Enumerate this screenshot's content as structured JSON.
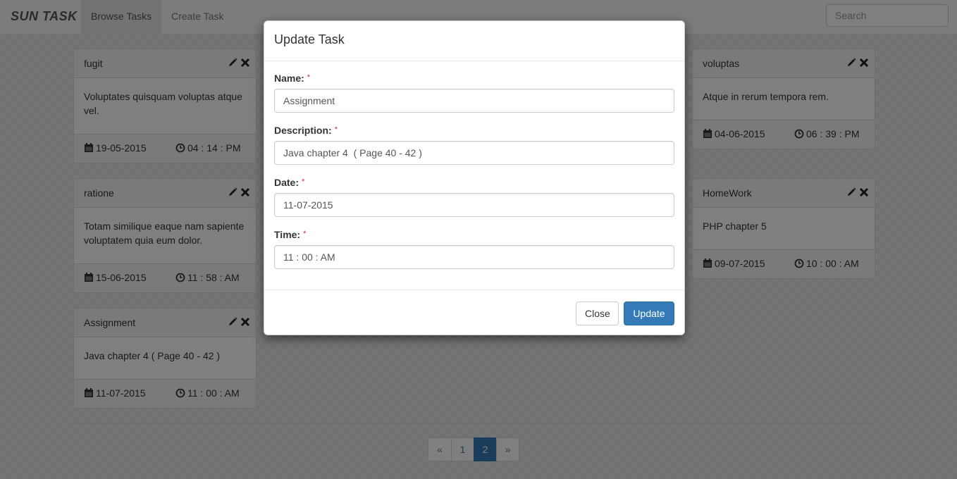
{
  "navbar": {
    "brand": "SUN TASK",
    "tabs": [
      {
        "label": "Browse Tasks",
        "active": true
      },
      {
        "label": "Create Task",
        "active": false
      }
    ],
    "search_placeholder": "Search"
  },
  "cards": [
    {
      "title": "fugit",
      "description": "Voluptates quisquam voluptas atque vel.",
      "date": "19-05-2015",
      "time": "04 : 14 : PM"
    },
    {
      "title": "ratione",
      "description": "Totam similique eaque nam sapiente voluptatem quia eum dolor.",
      "date": "15-06-2015",
      "time": "11 : 58 : AM"
    },
    {
      "title": "Assignment",
      "description": "Java chapter 4 ( Page 40 - 42 )",
      "date": "11-07-2015",
      "time": "11 : 00 : AM"
    },
    {
      "title": "voluptas",
      "description": "Atque in rerum tempora rem.",
      "date": "04-06-2015",
      "time": "06 : 39 : PM"
    },
    {
      "title": "HomeWork",
      "description": "PHP chapter 5",
      "date": "09-07-2015",
      "time": "10 : 00 : AM"
    }
  ],
  "pagination": {
    "prev": "«",
    "pages": [
      "1",
      "2"
    ],
    "current": "2",
    "next": "»"
  },
  "modal": {
    "title": "Update Task",
    "required_mark": "*",
    "fields": {
      "name": {
        "label": "Name:",
        "value": "Assignment"
      },
      "description": {
        "label": "Description:",
        "value": "Java chapter 4  ( Page 40 - 42 )"
      },
      "date": {
        "label": "Date:",
        "value": "11-07-2015"
      },
      "time": {
        "label": "Time:",
        "value": "11 : 00 : AM"
      }
    },
    "buttons": {
      "close": "Close",
      "update": "Update"
    }
  },
  "colors": {
    "primary": "#337ab7",
    "required": "#c9302c",
    "backdrop": "rgba(0,0,0,0.5)"
  }
}
